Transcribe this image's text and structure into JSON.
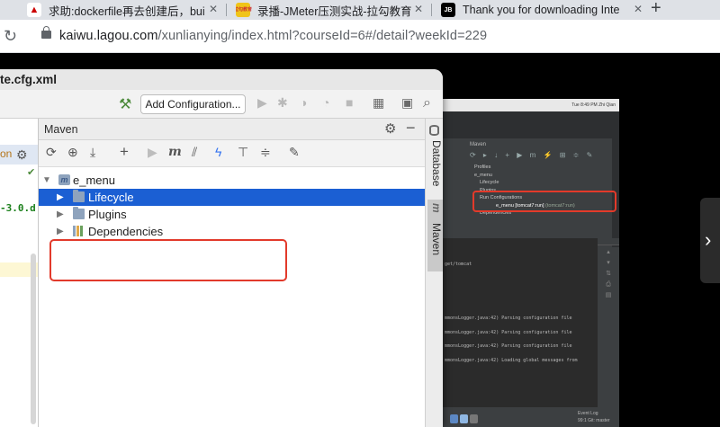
{
  "browser": {
    "tabs": [
      {
        "title": "求助:dockerfile再去创建后，bui",
        "favicon": "csdn-icon"
      },
      {
        "title": "录播-JMeter压测实战-拉勾教育",
        "favicon": "lagou-icon",
        "favicon_text": "拉勾教育"
      },
      {
        "title": "Thank you for downloading Inte",
        "favicon": "jetbrains-icon",
        "favicon_text": "JB"
      }
    ],
    "close_glyph": "✕",
    "add_tab_glyph": "+",
    "url_host": "kaiwu.lagou.com",
    "url_path": "/xunlianying/index.html?courseId=6#/detail?weekId=229"
  },
  "ide": {
    "window_title": "te.cfg.xml",
    "run_config_button": "Add Configuration...",
    "editor": {
      "fragment_row": "on",
      "code_fragment": "-3.0.d"
    },
    "maven": {
      "title": "Maven",
      "tree": [
        {
          "label": "e_menu",
          "level": 0,
          "expanded": true,
          "icon": "maven-module-icon"
        },
        {
          "label": "Lifecycle",
          "level": 1,
          "selected": true,
          "icon": "lifecycle-folder-icon"
        },
        {
          "label": "Plugins",
          "level": 1,
          "icon": "plugins-folder-icon"
        },
        {
          "label": "Dependencies",
          "level": 1,
          "icon": "dependencies-icon"
        }
      ]
    },
    "side_tabs": [
      "Database",
      "Maven"
    ]
  },
  "video": {
    "menubar": "Tue 8:49 PM   Zhi Qian",
    "maven_title": "Maven",
    "tree": [
      "Profiles",
      "e_menu",
      "Lifecycle",
      "Plugins",
      "Run Configurations",
      "e_menu [tomcat7:run]",
      "(tomcat7:run)",
      "Dependencies"
    ],
    "console_lines": [
      "get/tomcat",
      "mmonsLogger.java:42) Parsing configuration file",
      "mmonsLogger.java:42) Parsing configuration file",
      "mmonsLogger.java:42) Parsing configuration file",
      "mmonsLogger.java:42) Loading global messages from"
    ],
    "status": [
      "Event Log",
      "99:1  Git: master"
    ],
    "next_glyph": "›"
  },
  "colors": {
    "selection": "#1b5fd3",
    "annotation_red": "#e23a2b",
    "chrome_tabbar": "#dee1e6"
  }
}
